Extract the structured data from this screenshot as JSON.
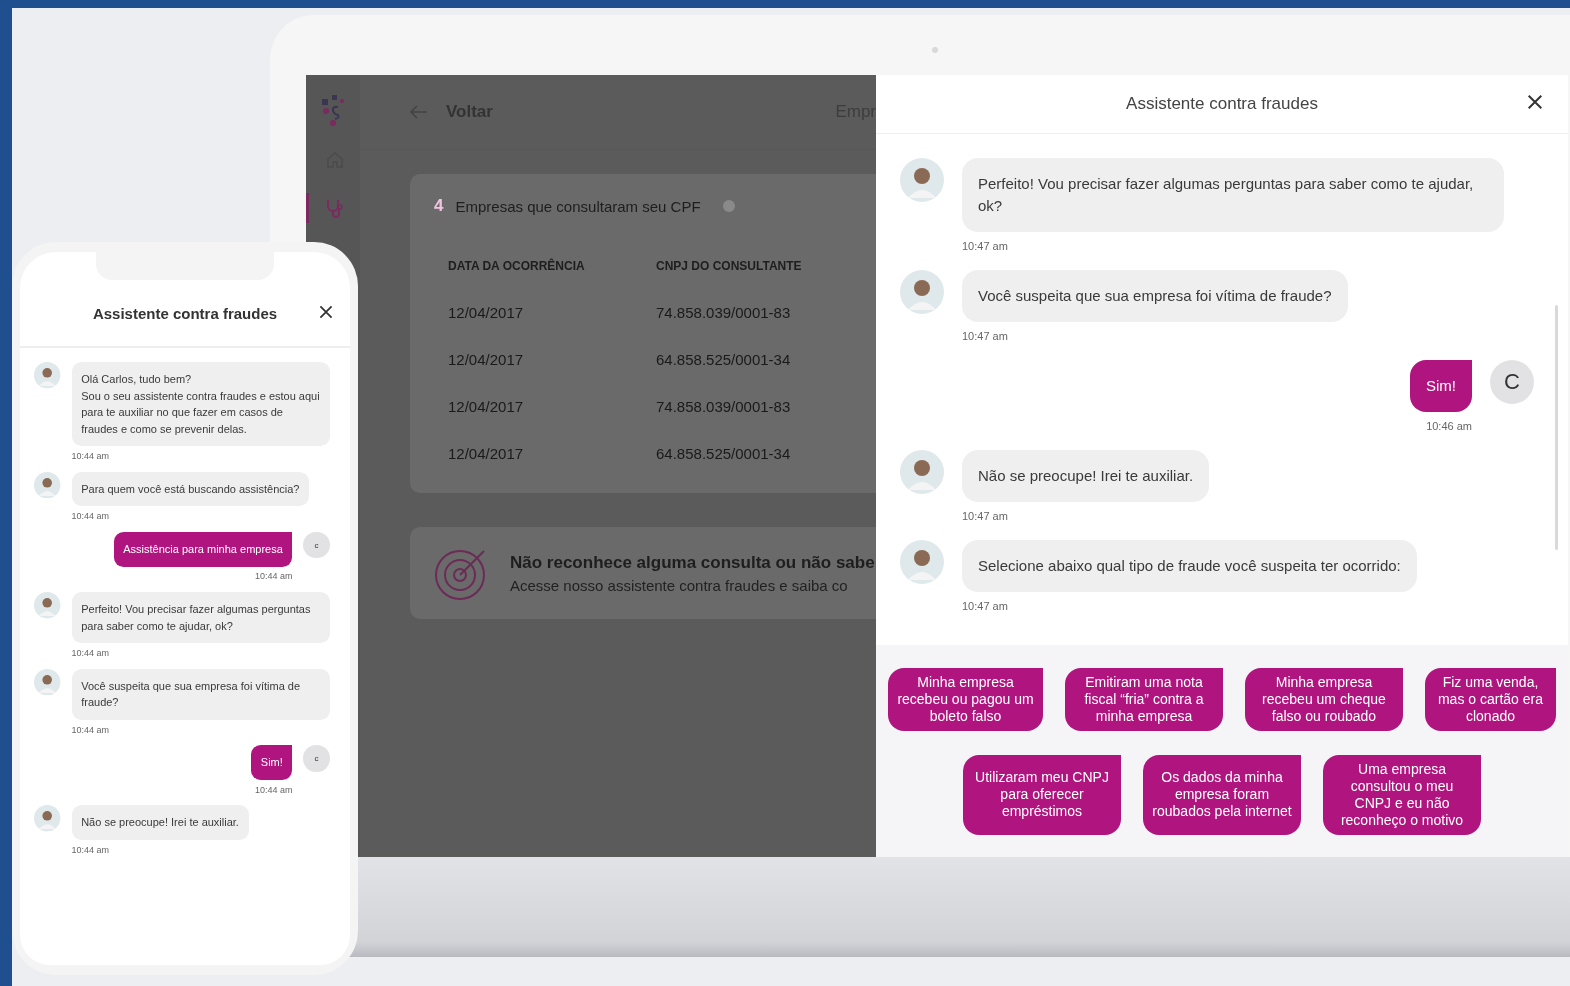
{
  "laptop": {
    "app": {
      "back_label": "Voltar",
      "header_partial": "Empr",
      "sidebar": [
        {
          "kind": "home",
          "selected": false
        },
        {
          "kind": "stethoscope",
          "selected": true
        }
      ],
      "card": {
        "count": "4",
        "title": "Empresas que consultaram seu CPF",
        "columns": [
          "DATA DA OCORRÊNCIA",
          "CNPJ DO CONSULTANTE"
        ],
        "rows": [
          [
            "12/04/2017",
            "74.858.039/0001-83"
          ],
          [
            "12/04/2017",
            "64.858.525/0001-34"
          ],
          [
            "12/04/2017",
            "74.858.039/0001-83"
          ],
          [
            "12/04/2017",
            "64.858.525/0001-34"
          ]
        ]
      },
      "banner": {
        "title": "Não reconhece alguma consulta ou não sabe",
        "subtitle": "Acesse nosso assistente contra fraudes e saiba co"
      }
    },
    "chat": {
      "title": "Assistente contra fraudes",
      "messages": [
        {
          "kind": "bot",
          "text": "Perfeito! Vou precisar fazer algumas perguntas para saber como te ajudar, ok?",
          "time": "10:47 am"
        },
        {
          "kind": "bot",
          "text": "Você suspeita que sua empresa foi vítima de fraude?",
          "time": "10:47 am"
        },
        {
          "kind": "user",
          "text": "Sim!",
          "time": "10:46 am",
          "initial": "C"
        },
        {
          "kind": "bot",
          "text": "Não se preocupe! Irei te auxiliar.",
          "time": "10:47 am"
        },
        {
          "kind": "bot",
          "text": "Selecione abaixo qual tipo de fraude você suspeita ter ocorrido:",
          "time": "10:47 am"
        }
      ],
      "option_rows": [
        [
          "Minha empresa recebeu ou pagou um boleto falso",
          "Emitiram uma nota fiscal “fria” contra a minha empresa",
          "Minha empresa recebeu um cheque falso ou roubado",
          "Fiz uma venda, mas o cartão era clonado"
        ],
        [
          "Utilizaram meu CNPJ para oferecer empréstimos",
          "Os dados da minha empresa foram roubados pela internet",
          "Uma empresa consultou o meu CNPJ e eu não reconheço o motivo"
        ]
      ]
    }
  },
  "phone": {
    "chat": {
      "title": "Assistente contra fraudes",
      "messages": [
        {
          "kind": "bot",
          "text": "Olá Carlos, tudo bem?\nSou o seu assistente contra fraudes e estou aqui para te auxiliar no que fazer em casos de fraudes e como se prevenir delas.",
          "time": "10:44 am"
        },
        {
          "kind": "bot",
          "text": "Para quem você está buscando assistência?",
          "time": "10:44 am"
        },
        {
          "kind": "user",
          "text": "Assistência para minha empresa",
          "time": "10:44 am",
          "initial": "c"
        },
        {
          "kind": "bot",
          "text": "Perfeito! Vou precisar fazer algumas perguntas para saber como te ajudar, ok?",
          "time": "10:44 am"
        },
        {
          "kind": "bot",
          "text": "Você suspeita que sua empresa foi vítima de fraude?",
          "time": "10:44 am"
        },
        {
          "kind": "user",
          "text": "Sim!",
          "time": "10:44 am",
          "initial": "c"
        },
        {
          "kind": "bot",
          "text": "Não se preocupe! Irei te auxiliar.",
          "time": "10:44 am"
        }
      ]
    }
  }
}
